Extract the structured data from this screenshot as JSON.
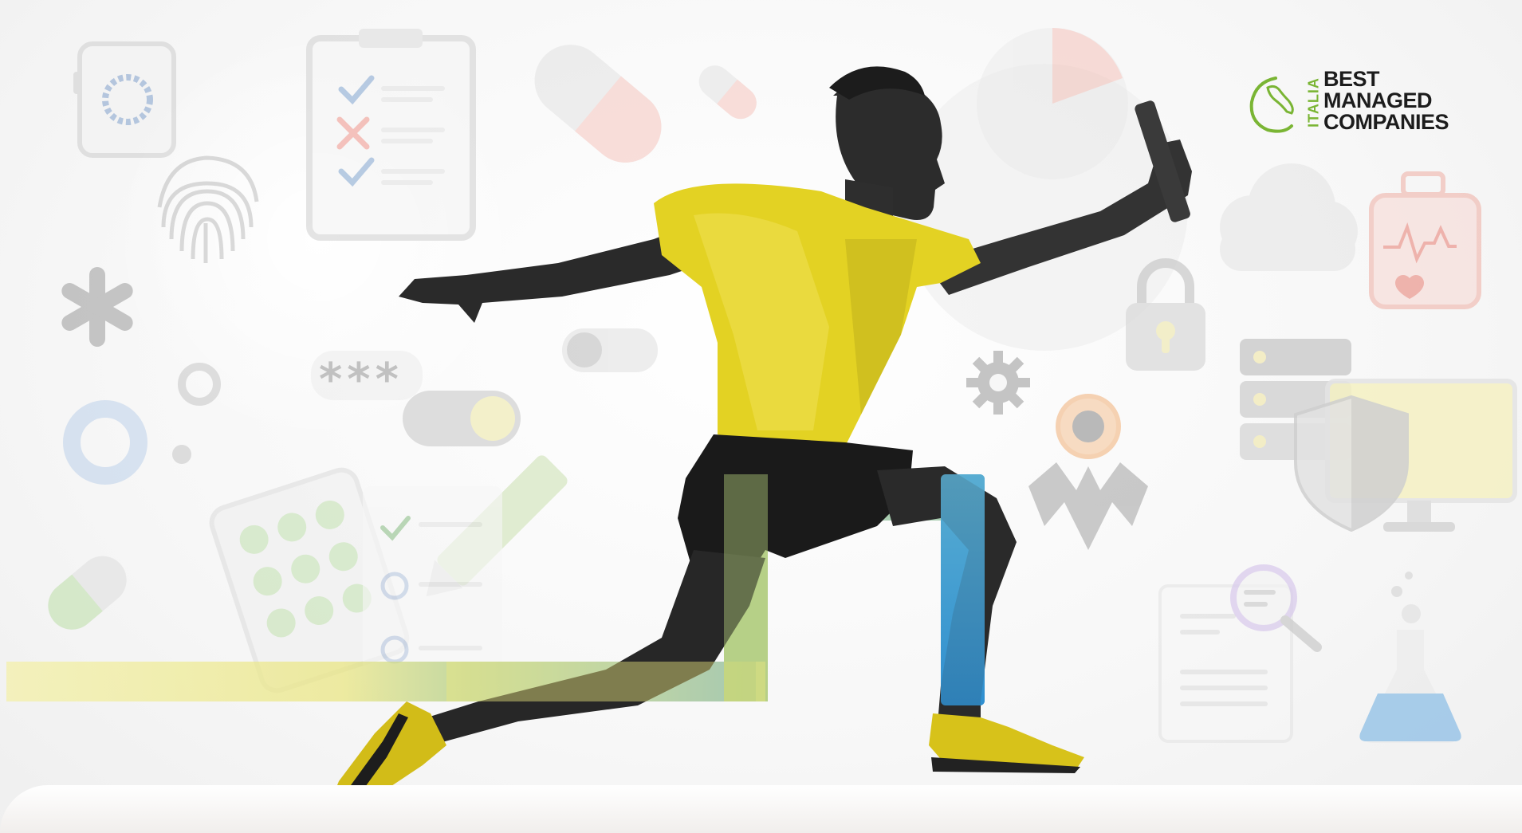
{
  "logo": {
    "side_label": "ITALIA",
    "line1": "BEST",
    "line2": "MANAGED",
    "line3": "COMPANIES",
    "accent_color": "#7ab534"
  },
  "icons": {
    "password_label": "***"
  },
  "colors": {
    "jersey": "#e3d223",
    "shorts": "#1a1a1a",
    "path_yellow": "#ecea8c",
    "path_green": "#9fbf6a",
    "path_blue": "#3b96d1",
    "icon_gray": "#c9c9c9",
    "icon_red": "#f2b1aa",
    "icon_green": "#b8dca8"
  }
}
